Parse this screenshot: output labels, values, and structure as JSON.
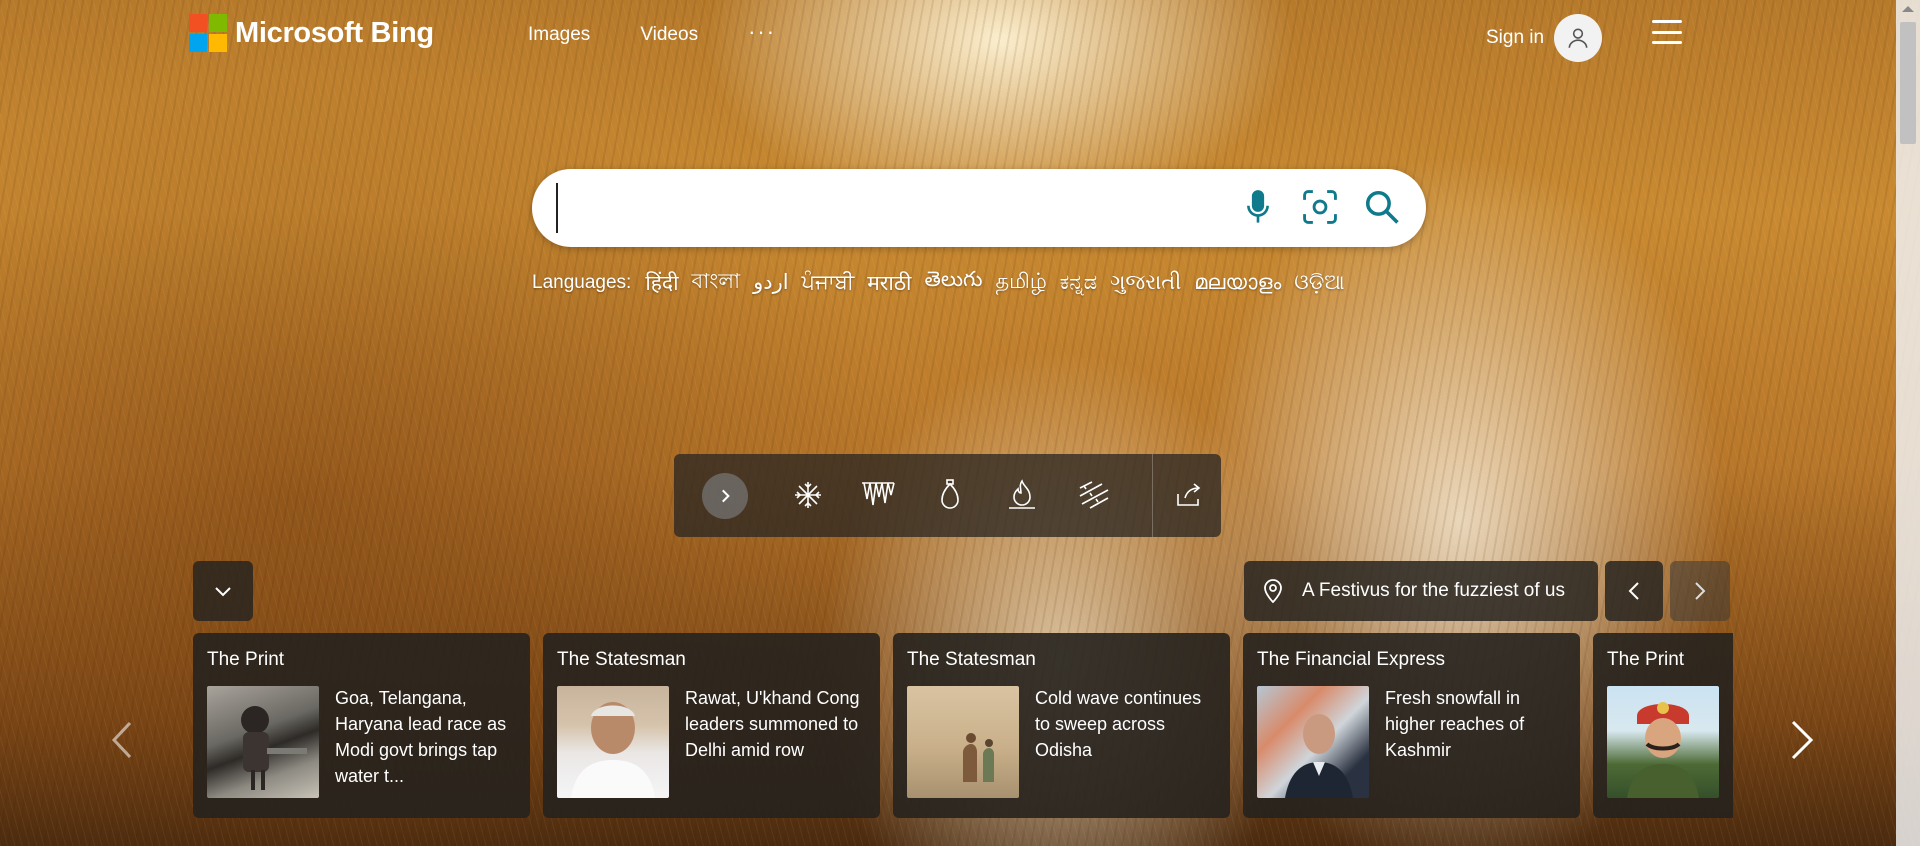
{
  "header": {
    "brand": "Microsoft Bing",
    "nav": [
      {
        "label": "Images"
      },
      {
        "label": "Videos"
      },
      {
        "label": "···"
      }
    ],
    "signin_label": "Sign in"
  },
  "search": {
    "placeholder": "",
    "value": ""
  },
  "languages": {
    "title": "Languages:",
    "items": [
      "हिंदी",
      "বাংলা",
      "اردو",
      "ਪੰਜਾਬੀ",
      "मराठी",
      "తెలుగు",
      "தமிழ்",
      "ಕನ್ನಡ",
      "ગુજરાતી",
      "മലയാളം",
      "ଓଡ଼ିଆ"
    ]
  },
  "toolbar": {
    "icons": [
      "next-chevron-icon",
      "snowflake-icon",
      "icicles-icon",
      "ornament-icon",
      "fire-icon",
      "wind-icon",
      "share-icon"
    ]
  },
  "caption": {
    "text": "A Festivus for the fuzziest of us"
  },
  "news": [
    {
      "source": "The Print",
      "title": "Goa, Telangana, Haryana lead race as Modi govt brings tap water t..."
    },
    {
      "source": "The Statesman",
      "title": "Rawat, U'khand Cong leaders summoned to Delhi amid row"
    },
    {
      "source": "The Statesman",
      "title": "Cold wave continues to sweep across Odisha"
    },
    {
      "source": "The Financial Express",
      "title": "Fresh snowfall in higher reaches of Kashmir"
    },
    {
      "source": "The Print",
      "title": ""
    }
  ],
  "colors": {
    "accent": "#0e7a8c",
    "logo_red": "#f25022",
    "logo_green": "#7fba00",
    "logo_blue": "#00a4ef",
    "logo_yellow": "#ffb900"
  }
}
